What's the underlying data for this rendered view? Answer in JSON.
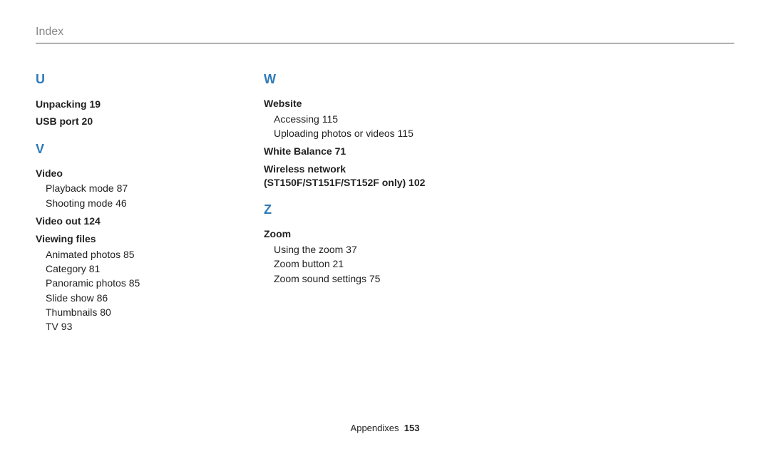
{
  "header": {
    "title": "Index"
  },
  "col1": {
    "letterU": "U",
    "unpacking": "Unpacking  19",
    "usbport": "USB port  20",
    "letterV": "V",
    "video": "Video",
    "video_sub": [
      "Playback mode  87",
      "Shooting mode  46"
    ],
    "videoout": "Video out  124",
    "viewingfiles": "Viewing files",
    "viewing_sub": [
      "Animated photos  85",
      "Category  81",
      "Panoramic photos  85",
      "Slide show  86",
      "Thumbnails  80",
      "TV  93"
    ]
  },
  "col2": {
    "letterW": "W",
    "website": "Website",
    "website_sub": [
      "Accessing  115",
      "Uploading photos or videos  115"
    ],
    "whitebalance": "White Balance  71",
    "wireless": "Wireless network (ST150F/ST151F/ST152F only)  102",
    "letterZ": "Z",
    "zoom": "Zoom",
    "zoom_sub": [
      "Using the zoom  37",
      "Zoom button  21",
      "Zoom sound settings  75"
    ]
  },
  "footer": {
    "section": "Appendixes",
    "page": "153"
  }
}
